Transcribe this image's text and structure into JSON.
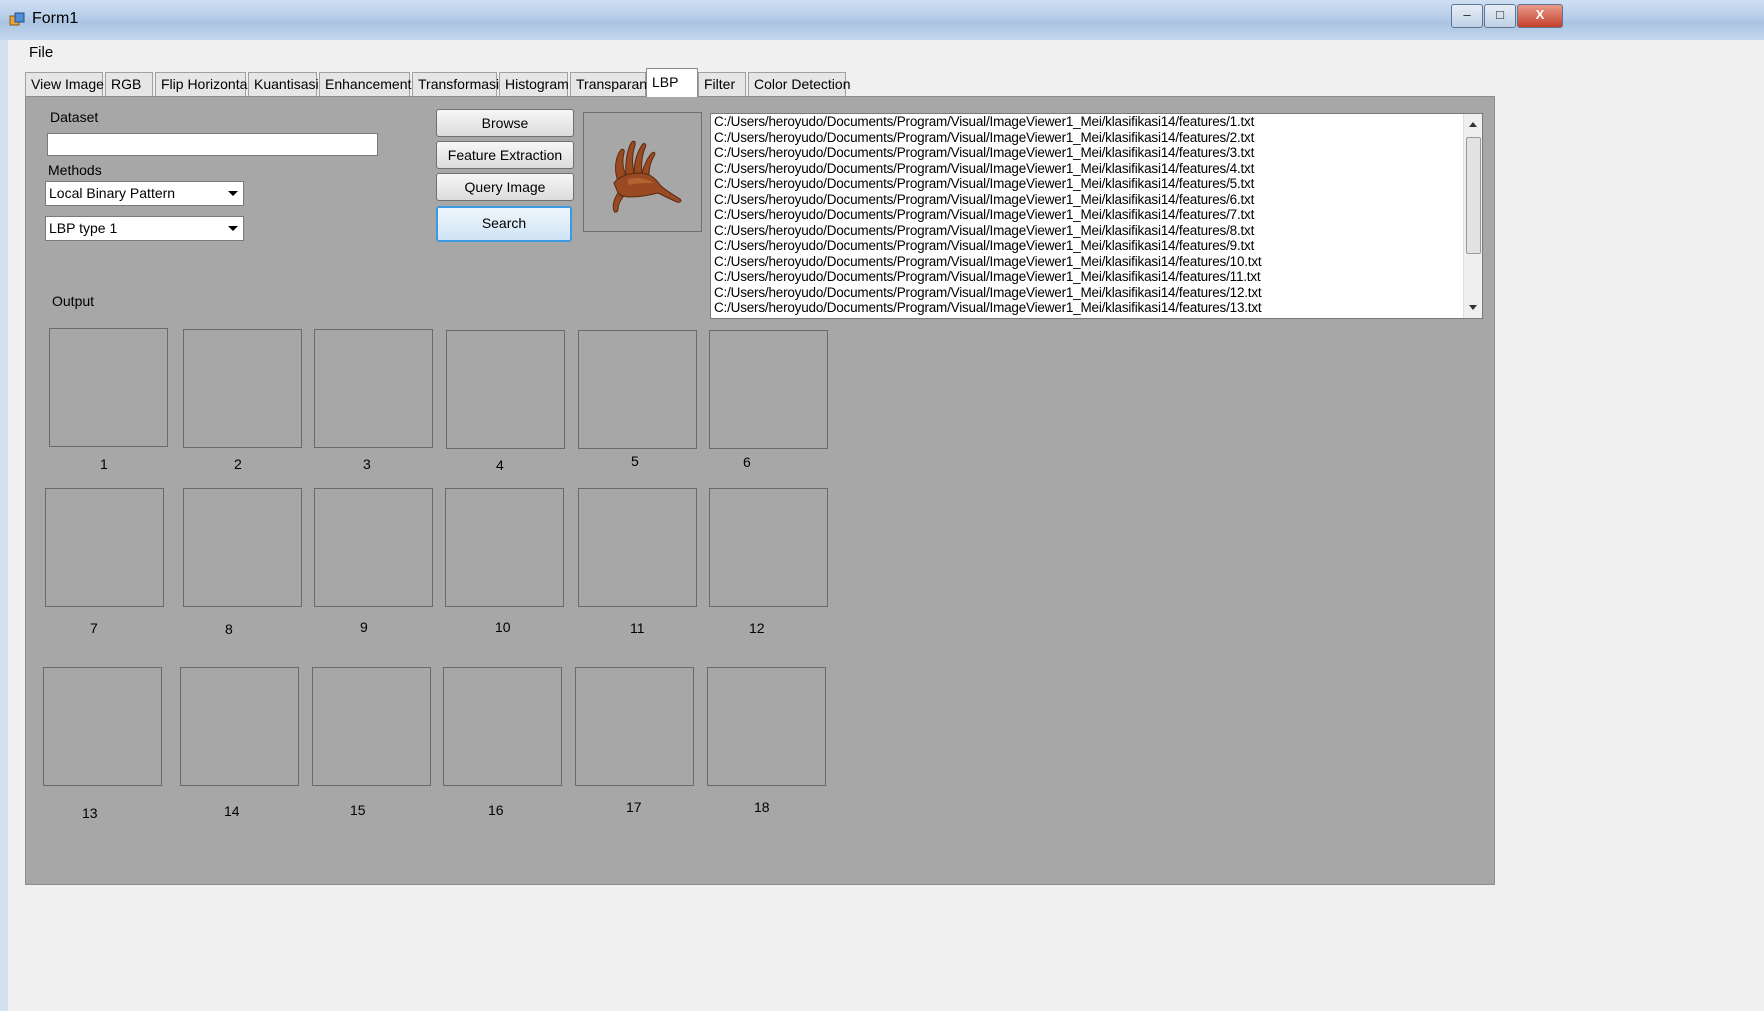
{
  "window": {
    "title": "Form1",
    "minimize_glyph": "–",
    "maximize_glyph": "□",
    "close_glyph": "X"
  },
  "menu": {
    "file_label": "File"
  },
  "tabs": [
    {
      "label": "View Image"
    },
    {
      "label": "RGB"
    },
    {
      "label": "Flip Horizontal"
    },
    {
      "label": "Kuantisasi"
    },
    {
      "label": "Enhancement"
    },
    {
      "label": "Transformasi"
    },
    {
      "label": "Histogram"
    },
    {
      "label": "Transparan"
    },
    {
      "label": "LBP"
    },
    {
      "label": "Filter"
    },
    {
      "label": "Color Detection"
    }
  ],
  "active_tab": "LBP",
  "lbp": {
    "dataset_label": "Dataset",
    "dataset_value": "",
    "methods_label": "Methods",
    "method_selected": "Local Binary Pattern",
    "lbp_type_selected": "LBP type 1",
    "browse_label": "Browse",
    "feature_extraction_label": "Feature Extraction",
    "query_image_label": "Query Image",
    "search_label": "Search",
    "output_label": "Output",
    "query_image_icon": "hand-sculpture-image"
  },
  "feature_files": [
    "C:/Users/heroyudo/Documents/Program/Visual/ImageViewer1_Mei/klasifikasi14/features/1.txt",
    "C:/Users/heroyudo/Documents/Program/Visual/ImageViewer1_Mei/klasifikasi14/features/2.txt",
    "C:/Users/heroyudo/Documents/Program/Visual/ImageViewer1_Mei/klasifikasi14/features/3.txt",
    "C:/Users/heroyudo/Documents/Program/Visual/ImageViewer1_Mei/klasifikasi14/features/4.txt",
    "C:/Users/heroyudo/Documents/Program/Visual/ImageViewer1_Mei/klasifikasi14/features/5.txt",
    "C:/Users/heroyudo/Documents/Program/Visual/ImageViewer1_Mei/klasifikasi14/features/6.txt",
    "C:/Users/heroyudo/Documents/Program/Visual/ImageViewer1_Mei/klasifikasi14/features/7.txt",
    "C:/Users/heroyudo/Documents/Program/Visual/ImageViewer1_Mei/klasifikasi14/features/8.txt",
    "C:/Users/heroyudo/Documents/Program/Visual/ImageViewer1_Mei/klasifikasi14/features/9.txt",
    "C:/Users/heroyudo/Documents/Program/Visual/ImageViewer1_Mei/klasifikasi14/features/10.txt",
    "C:/Users/heroyudo/Documents/Program/Visual/ImageViewer1_Mei/klasifikasi14/features/11.txt",
    "C:/Users/heroyudo/Documents/Program/Visual/ImageViewer1_Mei/klasifikasi14/features/12.txt",
    "C:/Users/heroyudo/Documents/Program/Visual/ImageViewer1_Mei/klasifikasi14/features/13.txt"
  ],
  "output_labels": [
    "1",
    "2",
    "3",
    "4",
    "5",
    "6",
    "7",
    "8",
    "9",
    "10",
    "11",
    "12",
    "13",
    "14",
    "15",
    "16",
    "17",
    "18"
  ],
  "colors": {
    "panel_bg": "#a7a7a7",
    "focus_border": "#3c9ae0",
    "titlebar": "#b5cde9"
  }
}
